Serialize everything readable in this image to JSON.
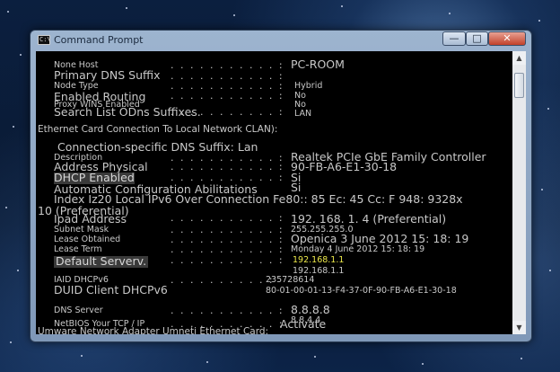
{
  "window": {
    "title": "Command Prompt",
    "icon_text": "C:\\",
    "controls": {
      "minimize": "—",
      "maximize": "□",
      "close": "✕"
    }
  },
  "console": {
    "lines": [
      {
        "label": "None Host",
        "value": "PC-ROOM"
      },
      {
        "label": "Primary DNS Suffix",
        "value": ""
      },
      {
        "label": "Node Type",
        "value": "Hybrid"
      },
      {
        "label": "Enabled Routing",
        "value": "No"
      },
      {
        "label": "Proxy WINS Enabled",
        "value": "No"
      },
      {
        "label": "Search List ODns Suffixes.",
        "value": "LAN"
      },
      {
        "label": "Ethernet Card Connection To Local Network CLAN):",
        "value": ""
      },
      {
        "label": "Connection-specific DNS Suffix: Lan",
        "value": ""
      },
      {
        "label": "Description",
        "value": "Realtek PCIe GbE Family Controller"
      },
      {
        "label": "Address Physical",
        "value": "90-FB-A6-E1-30-18"
      },
      {
        "label": "DHCP Enabled",
        "value": "Si"
      },
      {
        "label": "Automatic Configuration Abilitations",
        "value": "Si"
      },
      {
        "label": "Index Iz20 Local IPv6 Over Connection Fe80:: 85 Ec: 45 Cc: F 948: 9328x",
        "value": ""
      },
      {
        "label": "10 (Preferential)",
        "value": ""
      },
      {
        "label": "Ipad Address",
        "value": "192. 168. 1. 4 (Preferential)"
      },
      {
        "label": "Subnet Mask",
        "value": "255.255.255.0"
      },
      {
        "label": "Lease Obtained",
        "value": "Openica 3 June 2012 15: 18: 19"
      },
      {
        "label": "Lease Term",
        "value": "Monday 4 June 2012 15: 18: 19"
      },
      {
        "label": "Default Serverv.",
        "value": "192.168.1.1"
      },
      {
        "label": "",
        "value": "192.168.1.1"
      },
      {
        "label": "IAID DHCPv6",
        "value": "235728614"
      },
      {
        "label": "DUID Client DHCPv6",
        "value": "80-01-00-01-13-F4-37-0F-90-FB-A6-E1-30-18"
      },
      {
        "label": "DNS Server",
        "value": "8.8.8.8"
      },
      {
        "label": "",
        "value": "8.8.4.4"
      },
      {
        "label": "NetBIOS Your TCP / IP",
        "value": "Activate"
      },
      {
        "label": "Umware Network Adapter Umneti Ethernet Card:",
        "value": ""
      }
    ]
  },
  "colors": {
    "console_bg": "#000000",
    "console_text": "#c8c8c8",
    "highlight_yellow": "#ece84a"
  }
}
